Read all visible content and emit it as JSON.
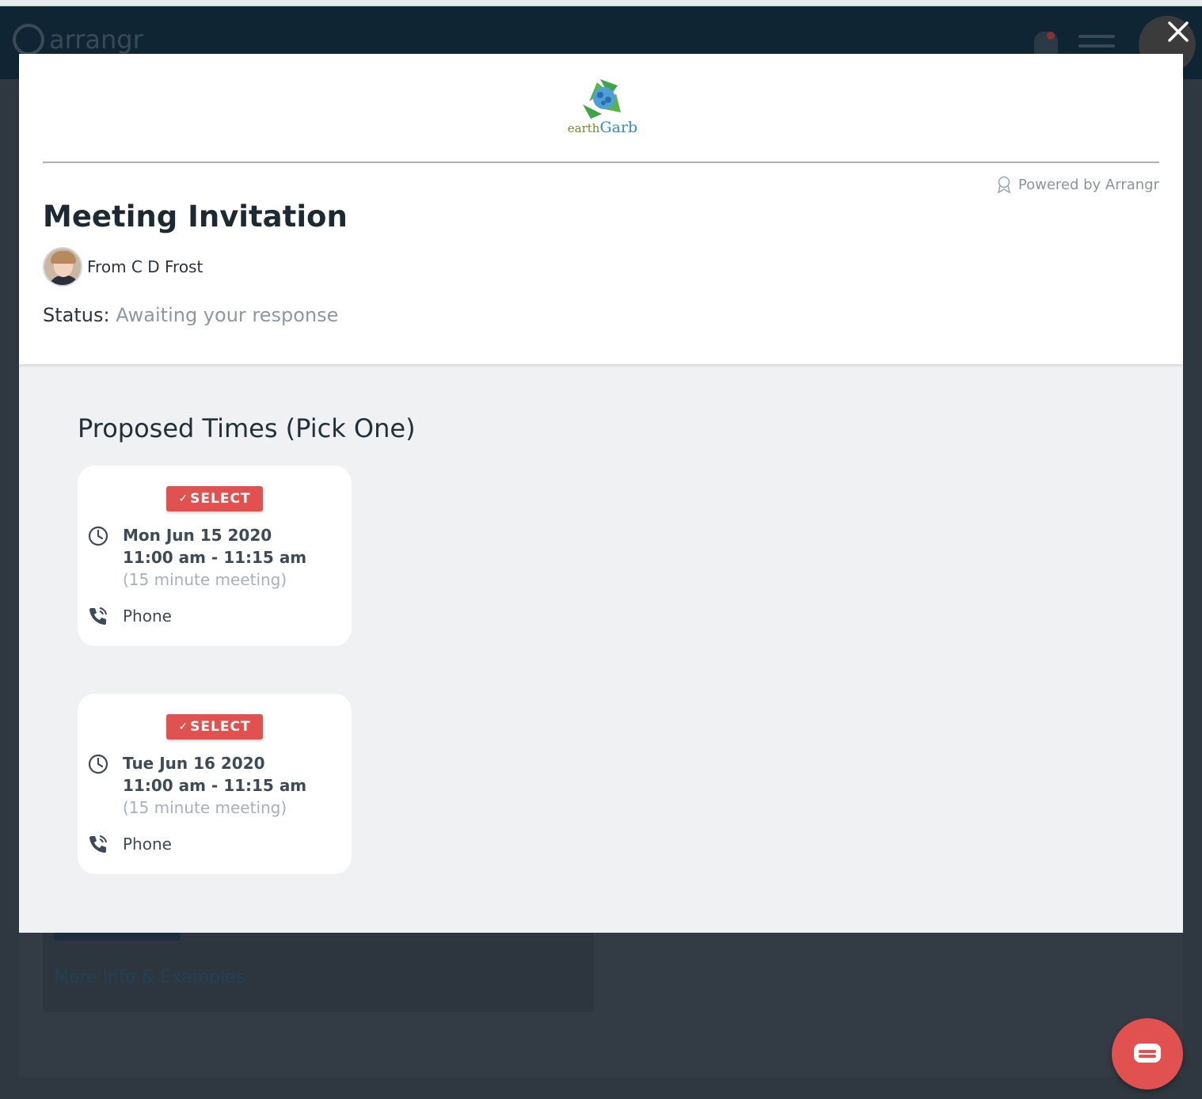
{
  "background": {
    "app_logo_text": "arrangr",
    "card_link": "More Info & Examples"
  },
  "modal": {
    "brand": {
      "word1": "earth",
      "word2": "Garb"
    },
    "powered_by": "Powered by Arrangr",
    "title": "Meeting Invitation",
    "from": "From C D Frost",
    "status_label": "Status:",
    "status_value": "Awaiting your response",
    "section_title": "Proposed Times (Pick One)",
    "select_check": "✓",
    "select_label": "SELECT",
    "slots": [
      {
        "date": "Mon Jun 15 2020",
        "time": "11:00 am - 11:15 am",
        "duration": "(15 minute meeting)",
        "location": "Phone"
      },
      {
        "date": "Tue Jun 16 2020",
        "time": "11:00 am - 11:15 am",
        "duration": "(15 minute meeting)",
        "location": "Phone"
      }
    ]
  },
  "colors": {
    "accent_red": "#e0514f",
    "status_gray": "#8b98a3",
    "header_navy": "#0f2534"
  },
  "icons": [
    "close-icon",
    "clock-icon",
    "phone-icon",
    "ribbon-icon",
    "chat-icon",
    "bell-icon",
    "menu-icon",
    "recycle-logo-icon"
  ]
}
